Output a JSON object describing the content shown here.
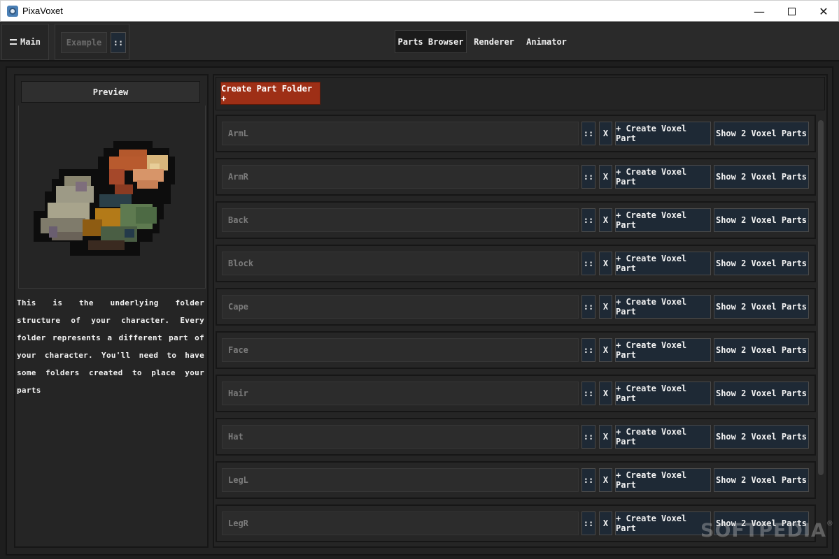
{
  "window": {
    "title": "PixaVoxet",
    "minimize_label": "—",
    "close_label": "✕"
  },
  "topbar": {
    "menu_label": "Main",
    "project_name": "Example",
    "project_options": "::",
    "tabs": [
      {
        "label": "Parts Browser",
        "active": true
      },
      {
        "label": "Renderer",
        "active": false
      },
      {
        "label": "Animator",
        "active": false
      }
    ]
  },
  "left_panel": {
    "preview_label": "Preview",
    "description": "This is the underlying folder structure of your character. Every folder represents a different part of your character. You'll need to have some folders created to place your parts"
  },
  "right_panel": {
    "create_folder_label": "Create Part Folder +",
    "folders": [
      {
        "name": "ArmL",
        "drag": "::",
        "delete": "X",
        "create": "+ Create Voxel Part",
        "show": "Show 2 Voxel Parts"
      },
      {
        "name": "ArmR",
        "drag": "::",
        "delete": "X",
        "create": "+ Create Voxel Part",
        "show": "Show 2 Voxel Parts"
      },
      {
        "name": "Back",
        "drag": "::",
        "delete": "X",
        "create": "+ Create Voxel Part",
        "show": "Show 2 Voxel Parts"
      },
      {
        "name": "Block",
        "drag": "::",
        "delete": "X",
        "create": "+ Create Voxel Part",
        "show": "Show 2 Voxel Parts"
      },
      {
        "name": "Cape",
        "drag": "::",
        "delete": "X",
        "create": "+ Create Voxel Part",
        "show": "Show 2 Voxel Parts"
      },
      {
        "name": "Face",
        "drag": "::",
        "delete": "X",
        "create": "+ Create Voxel Part",
        "show": "Show 2 Voxel Parts"
      },
      {
        "name": "Hair",
        "drag": "::",
        "delete": "X",
        "create": "+ Create Voxel Part",
        "show": "Show 2 Voxel Parts"
      },
      {
        "name": "Hat",
        "drag": "::",
        "delete": "X",
        "create": "+ Create Voxel Part",
        "show": "Show 2 Voxel Parts"
      },
      {
        "name": "LegL",
        "drag": "::",
        "delete": "X",
        "create": "+ Create Voxel Part",
        "show": "Show 2 Voxel Parts"
      },
      {
        "name": "LegR",
        "drag": "::",
        "delete": "X",
        "create": "+ Create Voxel Part",
        "show": "Show 2 Voxel Parts"
      }
    ]
  },
  "watermark": {
    "text": "SOFTPEDIA",
    "mark": "®"
  },
  "colors": {
    "accent_red": "#9e2f16",
    "button_navy": "#1e2935",
    "panel_bg": "#252525",
    "text": "#f2f2f2"
  },
  "icons": {
    "app": "pixavoxet-logo-icon",
    "menu": "hamburger-icon",
    "minimize": "minimize-icon",
    "maximize": "maximize-icon",
    "close": "close-icon"
  }
}
